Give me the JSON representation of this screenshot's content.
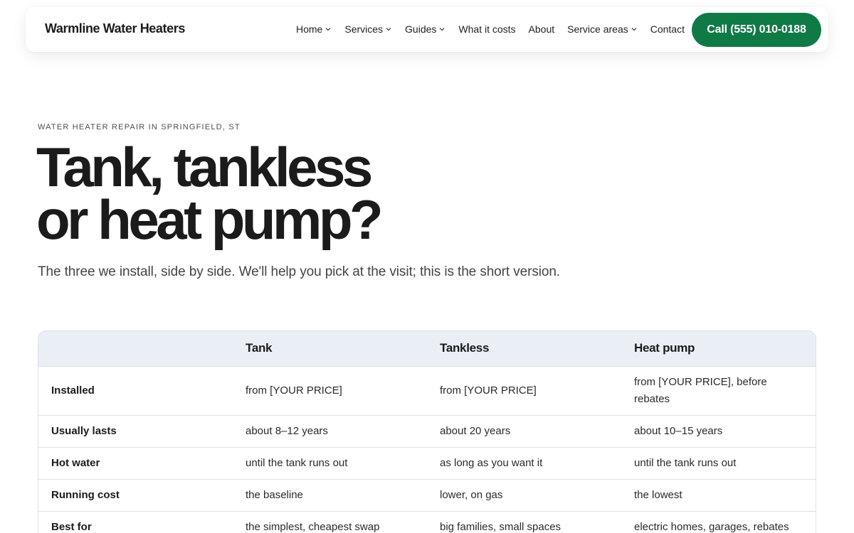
{
  "nav": {
    "brand": "Warmline Water Heaters",
    "items": [
      {
        "label": "Home",
        "dropdown": true
      },
      {
        "label": "Services",
        "dropdown": true
      },
      {
        "label": "Guides",
        "dropdown": true
      },
      {
        "label": "What it costs",
        "dropdown": false
      },
      {
        "label": "About",
        "dropdown": false
      },
      {
        "label": "Service areas",
        "dropdown": true
      },
      {
        "label": "Contact",
        "dropdown": false
      }
    ],
    "cta_label": "Call (555) 010-0188"
  },
  "hero": {
    "eyebrow": "WATER HEATER REPAIR IN SPRINGFIELD, ST",
    "title_line1": "Tank, tankless",
    "title_line2": "or heat pump?",
    "subtitle": "The three we install, side by side. We'll help you pick at the visit; this is the short version."
  },
  "comparison": {
    "headers": [
      "",
      "Tank",
      "Tankless",
      "Heat pump"
    ],
    "rows": [
      {
        "label": "Installed",
        "values": [
          "from [YOUR PRICE]",
          "from [YOUR PRICE]",
          "from [YOUR PRICE], before rebates"
        ]
      },
      {
        "label": "Usually lasts",
        "values": [
          "about 8–12 years",
          "about 20 years",
          "about 10–15 years"
        ]
      },
      {
        "label": "Hot water",
        "values": [
          "until the tank runs out",
          "as long as you want it",
          "until the tank runs out"
        ]
      },
      {
        "label": "Running cost",
        "values": [
          "the baseline",
          "lower, on gas",
          "the lowest"
        ]
      },
      {
        "label": "Best for",
        "values": [
          "the simplest, cheapest swap",
          "big families, small spaces",
          "electric homes, garages, rebates"
        ]
      }
    ]
  },
  "colors": {
    "accent": "#0f7a45",
    "table_header_bg": "#eaeff5"
  }
}
